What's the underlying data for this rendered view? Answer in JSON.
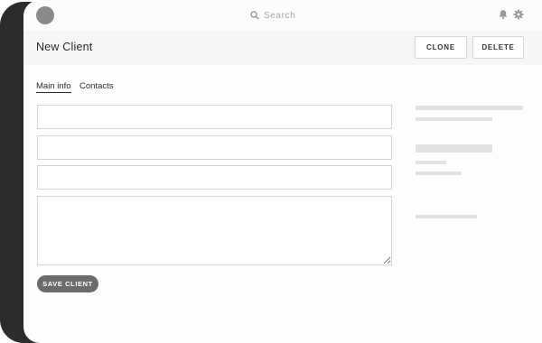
{
  "topbar": {
    "search_placeholder": "Search",
    "icons": [
      "avatar",
      "search-icon",
      "bell-icon",
      "gear-icon"
    ]
  },
  "header": {
    "title": "New Client",
    "clone_label": "CLONE",
    "delete_label": "DELETE"
  },
  "tabs": [
    {
      "label": "Main info",
      "active": true
    },
    {
      "label": "Contacts",
      "active": false
    }
  ],
  "form": {
    "fields": [
      {
        "value": "",
        "placeholder": ""
      },
      {
        "value": "",
        "placeholder": ""
      },
      {
        "value": "",
        "placeholder": ""
      },
      {
        "value": "",
        "placeholder": ""
      }
    ],
    "save_label": "SAVE CLIENT"
  },
  "colors": {
    "bezel": "#2c2c2c",
    "avatar": "#8a8a8a",
    "save_button": "#6b6b6b",
    "placeholder_bar": "#e2e2e2"
  }
}
